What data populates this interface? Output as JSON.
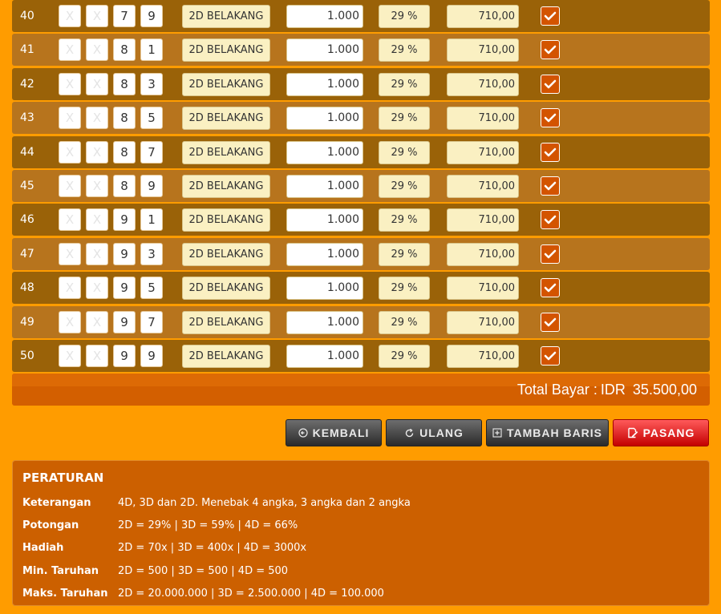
{
  "rows": [
    {
      "no": "40",
      "d1": "X",
      "d2": "X",
      "d3": "7",
      "d4": "9",
      "game": "2D BELAKANG",
      "bet": "1.000",
      "discount": "29 %",
      "pay": "710,00"
    },
    {
      "no": "41",
      "d1": "X",
      "d2": "X",
      "d3": "8",
      "d4": "1",
      "game": "2D BELAKANG",
      "bet": "1.000",
      "discount": "29 %",
      "pay": "710,00"
    },
    {
      "no": "42",
      "d1": "X",
      "d2": "X",
      "d3": "8",
      "d4": "3",
      "game": "2D BELAKANG",
      "bet": "1.000",
      "discount": "29 %",
      "pay": "710,00"
    },
    {
      "no": "43",
      "d1": "X",
      "d2": "X",
      "d3": "8",
      "d4": "5",
      "game": "2D BELAKANG",
      "bet": "1.000",
      "discount": "29 %",
      "pay": "710,00"
    },
    {
      "no": "44",
      "d1": "X",
      "d2": "X",
      "d3": "8",
      "d4": "7",
      "game": "2D BELAKANG",
      "bet": "1.000",
      "discount": "29 %",
      "pay": "710,00"
    },
    {
      "no": "45",
      "d1": "X",
      "d2": "X",
      "d3": "8",
      "d4": "9",
      "game": "2D BELAKANG",
      "bet": "1.000",
      "discount": "29 %",
      "pay": "710,00"
    },
    {
      "no": "46",
      "d1": "X",
      "d2": "X",
      "d3": "9",
      "d4": "1",
      "game": "2D BELAKANG",
      "bet": "1.000",
      "discount": "29 %",
      "pay": "710,00"
    },
    {
      "no": "47",
      "d1": "X",
      "d2": "X",
      "d3": "9",
      "d4": "3",
      "game": "2D BELAKANG",
      "bet": "1.000",
      "discount": "29 %",
      "pay": "710,00"
    },
    {
      "no": "48",
      "d1": "X",
      "d2": "X",
      "d3": "9",
      "d4": "5",
      "game": "2D BELAKANG",
      "bet": "1.000",
      "discount": "29 %",
      "pay": "710,00"
    },
    {
      "no": "49",
      "d1": "X",
      "d2": "X",
      "d3": "9",
      "d4": "7",
      "game": "2D BELAKANG",
      "bet": "1.000",
      "discount": "29 %",
      "pay": "710,00"
    },
    {
      "no": "50",
      "d1": "X",
      "d2": "X",
      "d3": "9",
      "d4": "9",
      "game": "2D BELAKANG",
      "bet": "1.000",
      "discount": "29 %",
      "pay": "710,00"
    }
  ],
  "total": {
    "label": "Total Bayar :",
    "currency": "IDR",
    "amount": "35.500,00"
  },
  "buttons": {
    "kembali": "KEMBALI",
    "ulang": "ULANG",
    "tambah": "TAMBAH BARIS",
    "pasang": "PASANG"
  },
  "rules": {
    "title": "PERATURAN",
    "items": [
      {
        "label": "Keterangan",
        "value": "4D, 3D dan 2D. Menebak 4 angka, 3 angka dan 2 angka"
      },
      {
        "label": "Potongan",
        "value": "2D = 29% | 3D = 59% | 4D = 66%"
      },
      {
        "label": "Hadiah",
        "value": "2D = 70x | 3D = 400x | 4D = 3000x"
      },
      {
        "label": "Min. Taruhan",
        "value": "2D = 500 | 3D = 500 | 4D = 500"
      },
      {
        "label": "Maks. Taruhan",
        "value": "2D = 20.000.000 | 3D = 2.500.000 | 4D = 100.000"
      }
    ]
  },
  "colors": {
    "background": "#ff9c00",
    "row_dark": "#9a6208",
    "row_light": "#b7741d",
    "checkbox": "#d35400",
    "pasang": "#e00000"
  }
}
